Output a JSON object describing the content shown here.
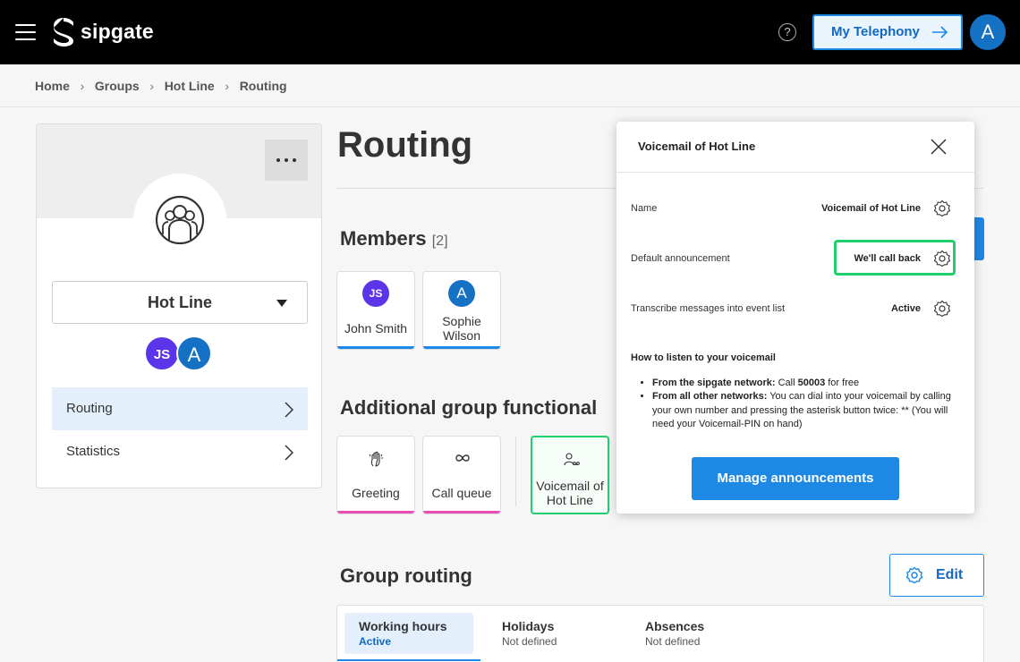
{
  "header": {
    "brand": "sipgate",
    "help_label": "?",
    "my_telephony_label": "My Telephony",
    "user_initial": "A",
    "colors": {
      "bg": "#000000",
      "accent": "#1e88e5"
    },
    "icons": [
      "menu-icon",
      "sipgate-logo",
      "help-icon",
      "arrow-right-icon"
    ]
  },
  "breadcrumb": [
    "Home",
    "Groups",
    "Hot Line",
    "Routing"
  ],
  "sidebar": {
    "group_name": "Hot Line",
    "members": [
      {
        "initials": "JS",
        "color": "#5b35ea"
      },
      {
        "initials": "A",
        "color": "#1471c4"
      }
    ],
    "nav": [
      {
        "label": "Routing",
        "active": true
      },
      {
        "label": "Statistics",
        "active": false
      }
    ]
  },
  "main": {
    "title": "Routing",
    "members_title": "Members",
    "members_count": "[2]",
    "members": [
      {
        "name": "John Smith",
        "initials": "JS",
        "color": "#5b35ea"
      },
      {
        "name": "Sophie Wilson",
        "initials": "A",
        "color": "#1471c4"
      }
    ],
    "functions_title": "Additional group functional",
    "functions": [
      {
        "name": "Greeting",
        "icon": "hand-wave-icon",
        "color": "#e84fb4"
      },
      {
        "name": "Call queue",
        "icon": "infinity-icon",
        "color": "#e84fb4"
      },
      {
        "name": "Voicemail of Hot Line",
        "icon": "voicemail-person-icon",
        "color": "#1ecf6e"
      }
    ],
    "routing_title": "Group routing",
    "edit_label": "Edit",
    "tabs": [
      {
        "title": "Working hours",
        "status": "Active",
        "active": true
      },
      {
        "title": "Holidays",
        "status": "Not defined",
        "active": false
      },
      {
        "title": "Absences",
        "status": "Not defined",
        "active": false
      }
    ]
  },
  "popover": {
    "title": "Voicemail of Hot Line",
    "rows": [
      {
        "label": "Name",
        "value": "Voicemail of Hot Line"
      },
      {
        "label": "Default announcement",
        "value": "We'll call back"
      },
      {
        "label": "Transcribe messages into event list",
        "value": "Active"
      }
    ],
    "howto_title": "How to listen to your voicemail",
    "howto_items": [
      {
        "bold": "From the sipgate network:",
        "pre": " Call ",
        "num": "50003",
        "post": " for free"
      },
      {
        "bold": "From all other networks:",
        "text": " You can dial into your voicemail by calling your own number and pressing the asterisk button twice: ** (You will need your Voicemail-PIN on hand)"
      }
    ],
    "manage_label": "Manage announcements"
  }
}
